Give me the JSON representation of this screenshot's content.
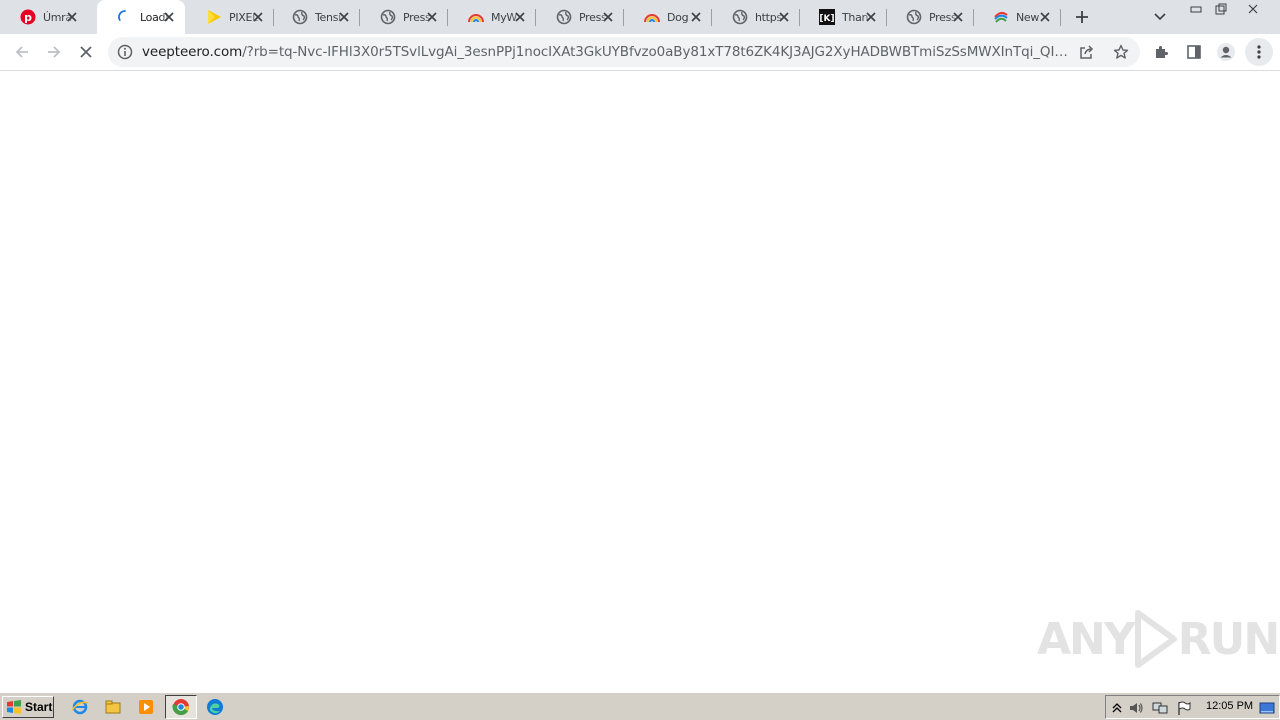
{
  "tabs": [
    {
      "title": "Úmra",
      "icon": "pinterest-icon",
      "active": false
    },
    {
      "title": "Loadi",
      "icon": "loading-spinner-icon",
      "active": true
    },
    {
      "title": "PIXEL",
      "icon": "play-arrow-icon",
      "active": false
    },
    {
      "title": "Tensi",
      "icon": "globe-icon",
      "active": false
    },
    {
      "title": "Press",
      "icon": "globe-icon",
      "active": false
    },
    {
      "title": "MyW",
      "icon": "rainbow-icon",
      "active": false
    },
    {
      "title": "Press",
      "icon": "globe-icon",
      "active": false
    },
    {
      "title": "Dog",
      "icon": "rainbow-icon",
      "active": false
    },
    {
      "title": "https",
      "icon": "globe-icon",
      "active": false
    },
    {
      "title": "Than",
      "icon": "k-logo-icon",
      "active": false
    },
    {
      "title": "Press",
      "icon": "globe-icon",
      "active": false
    },
    {
      "title": "New",
      "icon": "swirl-icon",
      "active": false
    }
  ],
  "address": {
    "host": "veepteero.com",
    "path": "/?rb=tq-Nvc-IFHl3X0r5TSvlLvgAi_3esnPPj1nocIXAt3GkUYBfvzo0aBy81xT78t6ZK4KJ3AJG2XyHADBWBTmiSzSsMWXInTqi_QILSAhWU..."
  },
  "watermark": {
    "text_left": "ANY",
    "text_right": "RUN"
  },
  "taskbar": {
    "start_label": "Start",
    "clock": "12:05 PM"
  }
}
